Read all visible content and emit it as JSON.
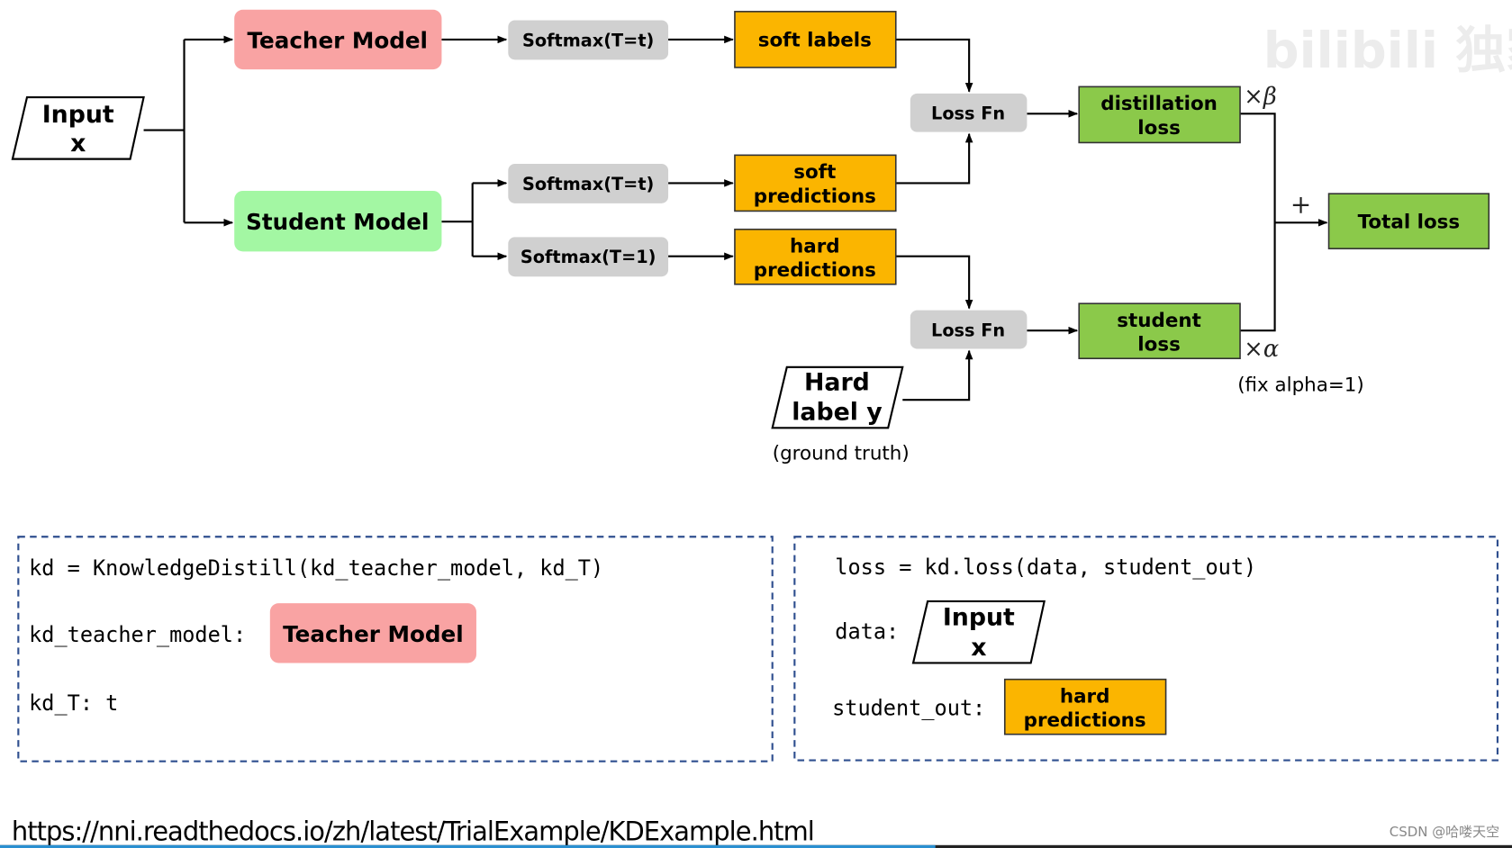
{
  "diagram": {
    "input": {
      "line1": "Input",
      "line2": "x"
    },
    "teacher_model": "Teacher Model",
    "student_model": "Student Model",
    "softmax_teacher": "Softmax(T=t)",
    "softmax_student_t": "Softmax(T=t)",
    "softmax_student_1": "Softmax(T=1)",
    "soft_labels": "soft labels",
    "soft_predictions": {
      "line1": "soft",
      "line2": "predictions"
    },
    "hard_predictions": {
      "line1": "hard",
      "line2": "predictions"
    },
    "loss_fn_top": "Loss Fn",
    "loss_fn_bottom": "Loss Fn",
    "distillation_loss": {
      "line1": "distillation",
      "line2": "loss"
    },
    "student_loss": {
      "line1": "student",
      "line2": "loss"
    },
    "total_loss": "Total loss",
    "hard_label": {
      "line1": "Hard",
      "line2": "label y"
    },
    "ground_truth": "(ground truth)",
    "times_beta": "×β",
    "times_alpha": "×α",
    "plus": "+",
    "fix_alpha": "(fix alpha=1)"
  },
  "code_left": {
    "line1": "kd = KnowledgeDistill(kd_teacher_model, kd_T)",
    "teacher_label": "kd_teacher_model:",
    "teacher_box": "Teacher Model",
    "kd_t": "kd_T: t"
  },
  "code_right": {
    "line1": "loss = kd.loss(data, student_out)",
    "data_label": "data:",
    "input": {
      "line1": "Input",
      "line2": "x"
    },
    "student_out_label": "student_out:",
    "hard_predictions": {
      "line1": "hard",
      "line2": "predictions"
    }
  },
  "footer": {
    "url": "https://nni.readthedocs.io/zh/latest/TrialExample/KDExample.html",
    "credit": "CSDN @哈喽天空"
  },
  "watermark": {
    "text": "bilibili 独家"
  },
  "colors": {
    "teacher": "#f9a3a3",
    "student": "#a3f7a3",
    "softmax": "#d0d0d0",
    "orange": "#fbb500",
    "green": "#8bc94a",
    "dashed_border": "#2f4f8f"
  }
}
